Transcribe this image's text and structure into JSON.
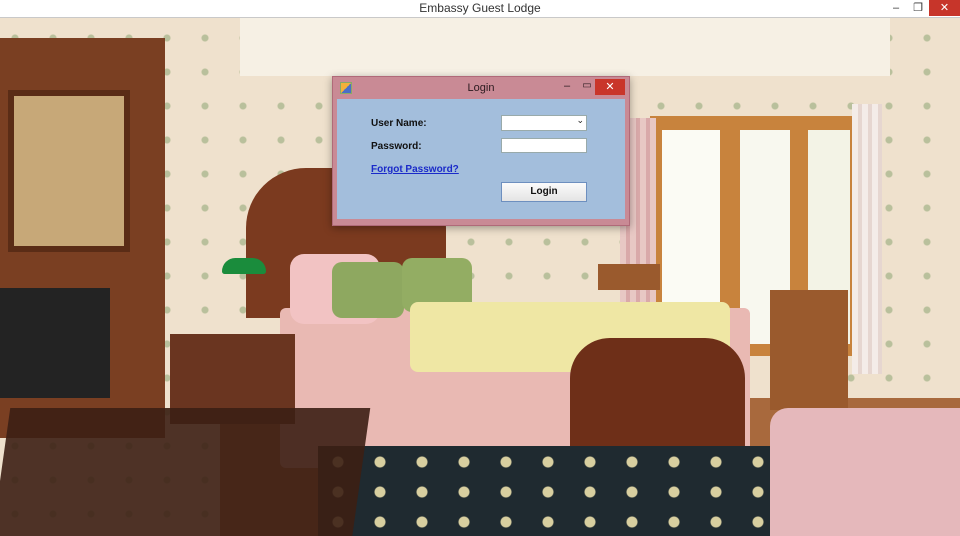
{
  "window": {
    "title": "Embassy Guest Lodge",
    "controls": {
      "minimize": "–",
      "maximize": "❐",
      "close": "✕"
    }
  },
  "login_dialog": {
    "title": "Login",
    "controls": {
      "minimize": "–",
      "maximize": "▭",
      "close": "✕"
    },
    "username_label": "User Name:",
    "username_value": "",
    "password_label": "Password:",
    "password_value": "",
    "forgot_password_link": "Forgot Password?",
    "login_button": "Login"
  },
  "colors": {
    "dialog_frame": "#c98a95",
    "dialog_body": "#a3bedc",
    "close_button": "#c9352a",
    "link": "#1a2ac9"
  },
  "icons": [
    "app-icon",
    "chevron-down-icon"
  ]
}
